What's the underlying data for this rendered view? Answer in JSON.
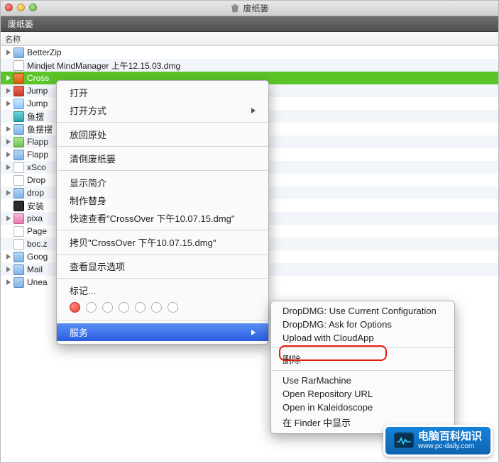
{
  "titlebar": {
    "title": "废纸篓"
  },
  "toolbar": {
    "title": "废纸篓"
  },
  "columns": {
    "name": "名称"
  },
  "items": [
    {
      "label": "BetterZip",
      "icon": "ic-folder",
      "disclosure": true
    },
    {
      "label": "Mindjet MindManager 上午12.15.03.dmg",
      "icon": "ic-dmg",
      "disclosure": false
    },
    {
      "label": "Cross",
      "icon": "ic-app",
      "disclosure": true,
      "selected": true
    },
    {
      "label": "Jump",
      "icon": "ic-red",
      "disclosure": true
    },
    {
      "label": "Jump",
      "icon": "ic-cloud",
      "disclosure": true
    },
    {
      "label": "鱼摆",
      "icon": "ic-teal",
      "disclosure": false
    },
    {
      "label": "鱼摆摆",
      "icon": "ic-folder",
      "disclosure": true
    },
    {
      "label": "Flapp",
      "icon": "ic-green",
      "disclosure": true
    },
    {
      "label": "Flapp",
      "icon": "ic-folder",
      "disclosure": true
    },
    {
      "label": "xSco",
      "icon": "ic-white",
      "disclosure": true
    },
    {
      "label": "Drop",
      "icon": "ic-white",
      "disclosure": false
    },
    {
      "label": "drop",
      "icon": "ic-folder",
      "disclosure": true
    },
    {
      "label": "安装",
      "icon": "ic-dark",
      "disclosure": false
    },
    {
      "label": "pixa",
      "icon": "ic-pink",
      "disclosure": true
    },
    {
      "label": "Page",
      "icon": "ic-white",
      "disclosure": false
    },
    {
      "label": "boc.z",
      "icon": "ic-white",
      "disclosure": false
    },
    {
      "label": "Goog",
      "icon": "ic-folder",
      "disclosure": true
    },
    {
      "label": "Mail",
      "icon": "ic-folder",
      "disclosure": true
    },
    {
      "label": "Unea",
      "icon": "ic-folder",
      "disclosure": true
    }
  ],
  "context_menu": {
    "open": "打开",
    "open_with": "打开方式",
    "put_back": "放回原处",
    "empty_trash": "清倒废纸篓",
    "get_info": "显示简介",
    "make_alias": "制作替身",
    "quick_look": "快速查看\"CrossOver 下午10.07.15.dmg\"",
    "copy": "拷贝\"CrossOver 下午10.07.15.dmg\"",
    "view_options": "查看显示选项",
    "tags": "标记...",
    "services": "服务"
  },
  "submenu": {
    "items": [
      "DropDMG: Use Current Configuration",
      "DropDMG: Ask for Options",
      "Upload with CloudApp",
      "删除",
      "Use RarMachine",
      "Open Repository URL",
      "Open in Kaleidoscope",
      "在 Finder 中显示"
    ],
    "highlighted_index": 3
  },
  "badge": {
    "title": "电脑百科知识",
    "url": "www.pc-daily.com"
  }
}
